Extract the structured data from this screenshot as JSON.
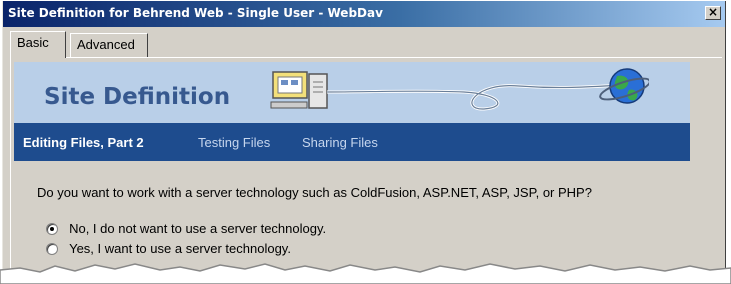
{
  "window": {
    "title": "Site Definition for Behrend Web - Single User - WebDav",
    "close_symbol": "×"
  },
  "tabs": [
    {
      "label": "Basic",
      "selected": true
    },
    {
      "label": "Advanced",
      "selected": false
    }
  ],
  "banner": {
    "title": "Site Definition",
    "icons": [
      "computer-icon",
      "globe-icon"
    ]
  },
  "wizard_steps": [
    {
      "label": "Editing Files, Part 2",
      "active": true
    },
    {
      "label": "Testing Files",
      "active": false
    },
    {
      "label": "Sharing Files",
      "active": false
    }
  ],
  "question": "Do you want to work with a server technology such as ColdFusion, ASP.NET, ASP, JSP, or PHP?",
  "options": [
    {
      "label": "No, I do not want to use a server technology.",
      "selected": true
    },
    {
      "label": "Yes, I want to use a server technology.",
      "selected": false
    }
  ],
  "colors": {
    "titlebar": "#0a246a",
    "banner": "#b9cfe8",
    "navbar": "#1e4c8e"
  }
}
